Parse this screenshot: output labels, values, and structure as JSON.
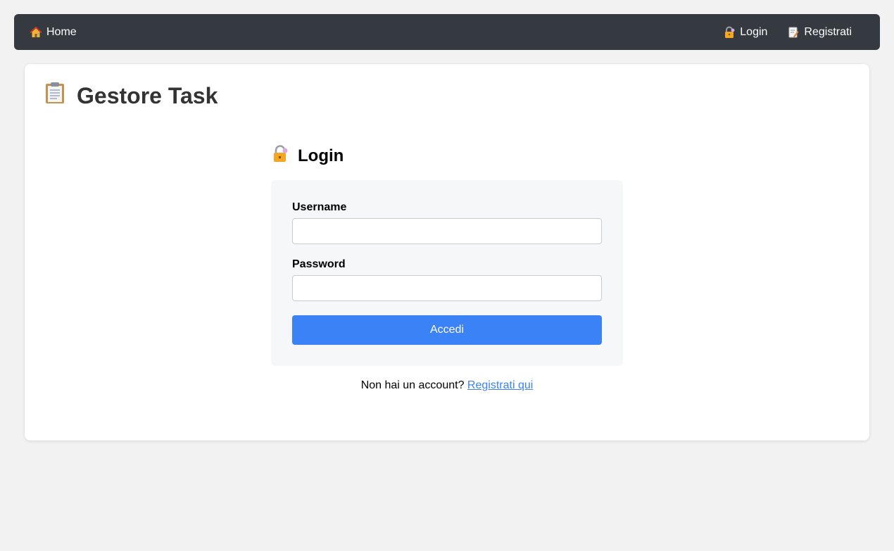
{
  "navbar": {
    "home_label": "Home",
    "login_label": "Login",
    "register_label": "Registrati"
  },
  "page": {
    "title": "Gestore Task"
  },
  "login_section": {
    "title": "Login",
    "username_label": "Username",
    "username_value": "",
    "password_label": "Password",
    "password_value": "",
    "submit_label": "Accedi",
    "no_account_text": "Non hai un account?",
    "register_link": "Registrati qui"
  },
  "icons": {
    "home": "house-icon",
    "login": "lock-icon",
    "register": "memo-icon",
    "title": "clipboard-icon"
  },
  "colors": {
    "navbar_bg": "#343a40",
    "accent": "#3b82f6",
    "page_bg": "#f2f2f2"
  }
}
